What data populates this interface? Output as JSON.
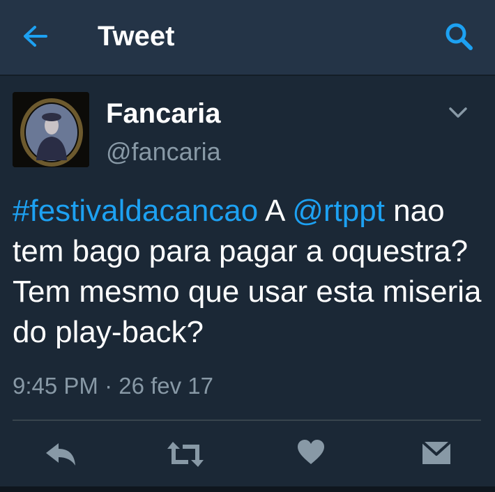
{
  "header": {
    "title": "Tweet",
    "back_icon": "arrow-left-icon",
    "search_icon": "search-icon"
  },
  "tweet": {
    "author_name": "Fancaria",
    "author_handle": "@fancaria",
    "text_hashtag": "#festivaldacancao",
    "text_a": " A ",
    "text_mention": "@rtppt",
    "text_rest": " nao tem bago para pagar a oquestra? Tem mesmo que usar esta miseria do play-back?",
    "timestamp": "9:45 PM · 26 fev 17"
  },
  "actions": [
    {
      "name": "reply",
      "icon": "reply-icon"
    },
    {
      "name": "retweet",
      "icon": "retweet-icon"
    },
    {
      "name": "like",
      "icon": "heart-icon"
    },
    {
      "name": "message",
      "icon": "envelope-icon"
    }
  ],
  "colors": {
    "header_bg": "#243447",
    "body_bg": "#1b2836",
    "accent": "#1da1f2",
    "muted": "#8899a6",
    "icon": "#8899a6"
  }
}
